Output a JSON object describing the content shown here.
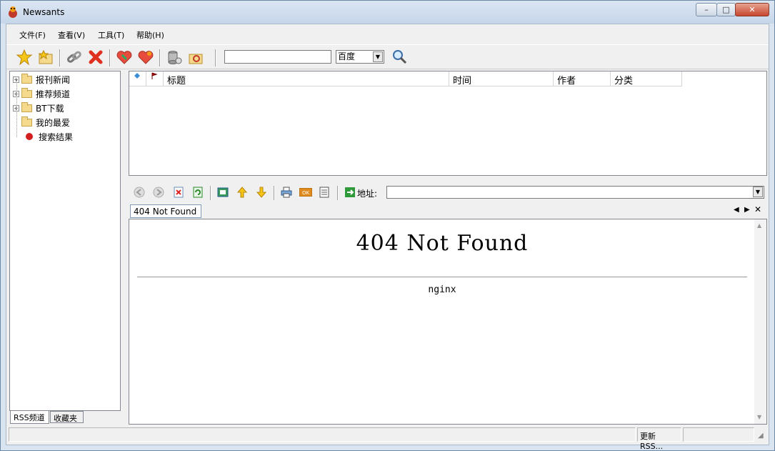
{
  "window": {
    "title": "Newsants",
    "minimize_glyph": "–",
    "maximize_glyph": "□",
    "close_glyph": "✕"
  },
  "menu": [
    "文件(F)",
    "查看(V)",
    "工具(T)",
    "帮助(H)"
  ],
  "toolbar": {
    "search_value": "",
    "engine": "百度",
    "icons": [
      "star-icon",
      "folder-star-icon",
      "link-icon",
      "delete-icon",
      "rss-down-icon",
      "rss-heart-icon",
      "database-icon",
      "config-folder-icon",
      "search-icon"
    ]
  },
  "tree": {
    "items": [
      {
        "label": "报刊新闻",
        "expander": "+"
      },
      {
        "label": "推荐频道",
        "expander": "+"
      },
      {
        "label": "BT下载",
        "expander": "+"
      },
      {
        "label": "我的最爱",
        "expander": ""
      },
      {
        "label": "搜索结果",
        "expander": ""
      }
    ]
  },
  "bottom_tabs": [
    "RSS频道",
    "收藏夹"
  ],
  "list": {
    "columns": [
      "标题",
      "时间",
      "作者",
      "分类"
    ]
  },
  "browser": {
    "address_label": "地址:",
    "address_value": ""
  },
  "doc_tab": {
    "label": "404 Not Found"
  },
  "page": {
    "heading": "404 Not Found",
    "footer": "nginx"
  },
  "status": {
    "update": "更新RSS...",
    "left": "",
    "right": ""
  },
  "colors": {
    "close_red": "#c7452f",
    "tree_red_dot": "#d21e1e"
  }
}
